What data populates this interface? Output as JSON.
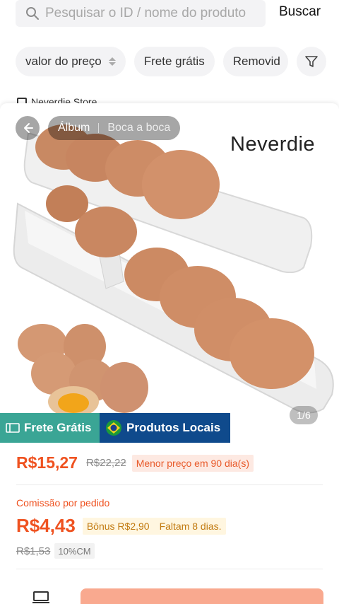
{
  "search": {
    "placeholder": "Pesquisar o ID / nome do produto",
    "button_label": "Buscar"
  },
  "filters": {
    "price_sort_label": "valor do preço",
    "free_shipping_label": "Frete grátis",
    "removed_label": "Removid"
  },
  "store": {
    "name": "Neverdie Store"
  },
  "product": {
    "album_label": "Álbum",
    "secondary_label": "Boca a boca",
    "brand": "Neverdie",
    "image_counter": "1/6",
    "badges": {
      "free_shipping": "Frete Grátis",
      "local_products": "Produtos Locais"
    },
    "price": "R$15,27",
    "original_price": "R$22,22",
    "lowest_price_note": "Menor preço em 90 dia(s)",
    "commission_label": "Comissão por pedido",
    "commission_value": "R$4,43",
    "bonus_text": "Bônus R$2,90",
    "days_left_text": "Faltam 8 dias.",
    "commission_old": "R$1,53",
    "commission_rate": "10%CM"
  },
  "colors": {
    "accent_orange": "#ef5220",
    "free_badge": "#3aa595",
    "local_badge": "#0f4a8c",
    "cta_button": "#f9a98f"
  },
  "icons": [
    "search-icon",
    "sort-icon",
    "filter-icon",
    "back-arrow-icon",
    "truck-icon",
    "brazil-flag-icon"
  ]
}
